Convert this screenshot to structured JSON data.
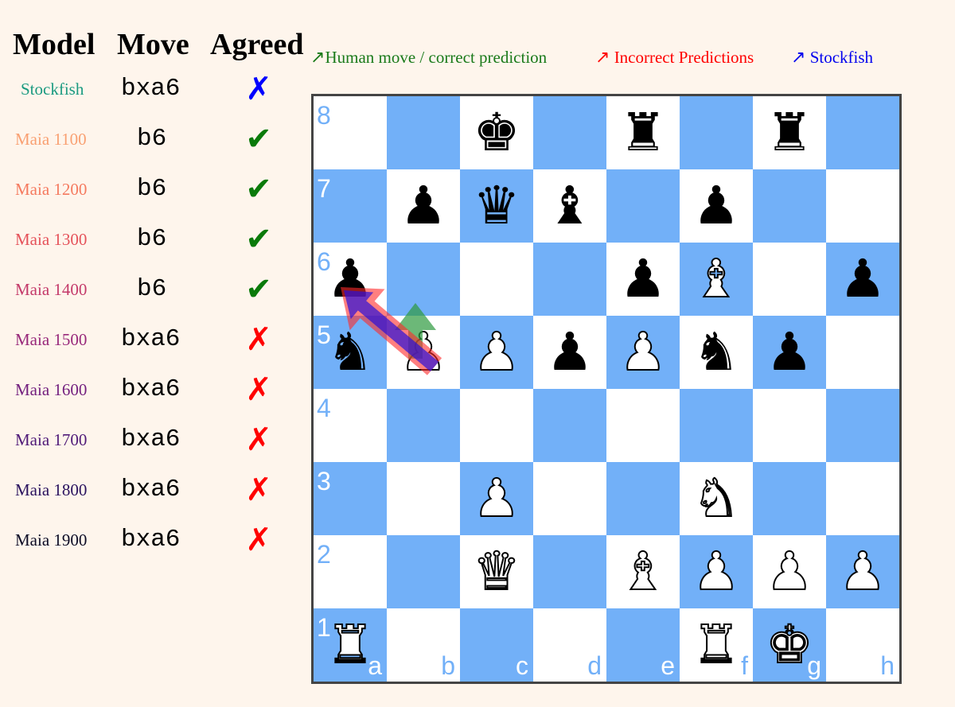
{
  "table": {
    "headers": {
      "model": "Model",
      "move": "Move",
      "agreed": "Agreed"
    },
    "rows": [
      {
        "model": "Stockfish",
        "color": "#1a9a80",
        "move": "bxa6",
        "agreed": false,
        "mark": "✗",
        "mark_color": "#0000ff"
      },
      {
        "model": "Maia 1100",
        "color": "#f9a072",
        "move": "b6",
        "agreed": true,
        "mark": "✔",
        "mark_color": "#0a7a0a"
      },
      {
        "model": "Maia 1200",
        "color": "#f57a5f",
        "move": "b6",
        "agreed": true,
        "mark": "✔",
        "mark_color": "#0a7a0a"
      },
      {
        "model": "Maia 1300",
        "color": "#e5525a",
        "move": "b6",
        "agreed": true,
        "mark": "✔",
        "mark_color": "#0a7a0a"
      },
      {
        "model": "Maia 1400",
        "color": "#c43a6a",
        "move": "b6",
        "agreed": true,
        "mark": "✔",
        "mark_color": "#0a7a0a"
      },
      {
        "model": "Maia 1500",
        "color": "#98287a",
        "move": "bxa6",
        "agreed": false,
        "mark": "✗",
        "mark_color": "#ff0000"
      },
      {
        "model": "Maia 1600",
        "color": "#731f7e",
        "move": "bxa6",
        "agreed": false,
        "mark": "✗",
        "mark_color": "#ff0000"
      },
      {
        "model": "Maia 1700",
        "color": "#501a78",
        "move": "bxa6",
        "agreed": false,
        "mark": "✗",
        "mark_color": "#ff0000"
      },
      {
        "model": "Maia 1800",
        "color": "#2a125e",
        "move": "bxa6",
        "agreed": false,
        "mark": "✗",
        "mark_color": "#ff0000"
      },
      {
        "model": "Maia 1900",
        "color": "#0c0b25",
        "move": "bxa6",
        "agreed": false,
        "mark": "✗",
        "mark_color": "#ff0000"
      }
    ]
  },
  "legend": [
    {
      "arrow": "↗",
      "label": "Human move / correct prediction",
      "color": "#1a7a1a",
      "arrow_color": "#1a7a1a"
    },
    {
      "arrow": "↗",
      "label": "Incorrect Predictions",
      "color": "#ff0000",
      "arrow_color": "#ff0000"
    },
    {
      "arrow": "↗",
      "label": "Stockfish",
      "color": "#0000ee",
      "arrow_color": "#0000ee"
    }
  ],
  "board": {
    "light_color": "#ffffff",
    "dark_color": "#72b0f8",
    "files": [
      "a",
      "b",
      "c",
      "d",
      "e",
      "f",
      "g",
      "h"
    ],
    "ranks": [
      "8",
      "7",
      "6",
      "5",
      "4",
      "3",
      "2",
      "1"
    ],
    "pieces": [
      {
        "square": "c8",
        "piece": "king",
        "side": "black",
        "glyph": "♚"
      },
      {
        "square": "e8",
        "piece": "rook",
        "side": "black",
        "glyph": "♜"
      },
      {
        "square": "g8",
        "piece": "rook",
        "side": "black",
        "glyph": "♜"
      },
      {
        "square": "b7",
        "piece": "pawn",
        "side": "black",
        "glyph": "♟"
      },
      {
        "square": "c7",
        "piece": "queen",
        "side": "black",
        "glyph": "♛"
      },
      {
        "square": "d7",
        "piece": "bishop",
        "side": "black",
        "glyph": "♝"
      },
      {
        "square": "f7",
        "piece": "pawn",
        "side": "black",
        "glyph": "♟"
      },
      {
        "square": "a6",
        "piece": "pawn",
        "side": "black",
        "glyph": "♟"
      },
      {
        "square": "e6",
        "piece": "pawn",
        "side": "black",
        "glyph": "♟"
      },
      {
        "square": "f6",
        "piece": "bishop",
        "side": "white",
        "glyph": "♝"
      },
      {
        "square": "h6",
        "piece": "pawn",
        "side": "black",
        "glyph": "♟"
      },
      {
        "square": "a5",
        "piece": "knight",
        "side": "black",
        "glyph": "♞"
      },
      {
        "square": "b5",
        "piece": "pawn",
        "side": "white",
        "glyph": "♟"
      },
      {
        "square": "c5",
        "piece": "pawn",
        "side": "white",
        "glyph": "♟"
      },
      {
        "square": "d5",
        "piece": "pawn",
        "side": "black",
        "glyph": "♟"
      },
      {
        "square": "e5",
        "piece": "pawn",
        "side": "white",
        "glyph": "♟"
      },
      {
        "square": "f5",
        "piece": "knight",
        "side": "black",
        "glyph": "♞"
      },
      {
        "square": "g5",
        "piece": "pawn",
        "side": "black",
        "glyph": "♟"
      },
      {
        "square": "c3",
        "piece": "pawn",
        "side": "white",
        "glyph": "♟"
      },
      {
        "square": "f3",
        "piece": "knight",
        "side": "white",
        "glyph": "♞"
      },
      {
        "square": "c2",
        "piece": "queen",
        "side": "white",
        "glyph": "♛"
      },
      {
        "square": "e2",
        "piece": "bishop",
        "side": "white",
        "glyph": "♝"
      },
      {
        "square": "f2",
        "piece": "pawn",
        "side": "white",
        "glyph": "♟"
      },
      {
        "square": "g2",
        "piece": "pawn",
        "side": "white",
        "glyph": "♟"
      },
      {
        "square": "h2",
        "piece": "pawn",
        "side": "white",
        "glyph": "♟"
      },
      {
        "square": "a1",
        "piece": "rook",
        "side": "white",
        "glyph": "♜"
      },
      {
        "square": "f1",
        "piece": "rook",
        "side": "white",
        "glyph": "♜"
      },
      {
        "square": "g1",
        "piece": "king",
        "side": "white",
        "glyph": "♚"
      }
    ],
    "arrows": [
      {
        "type": "human-correct",
        "from": "b5",
        "to": "b6",
        "color": "#2e9a3e",
        "opacity": 0.7
      },
      {
        "type": "incorrect-prediction",
        "from": "b5",
        "to": "a6",
        "color": "#ff2a2a",
        "opacity": 0.6
      },
      {
        "type": "stockfish",
        "from": "b5",
        "to": "a6",
        "color": "#2a10d8",
        "opacity": 0.7
      }
    ]
  }
}
